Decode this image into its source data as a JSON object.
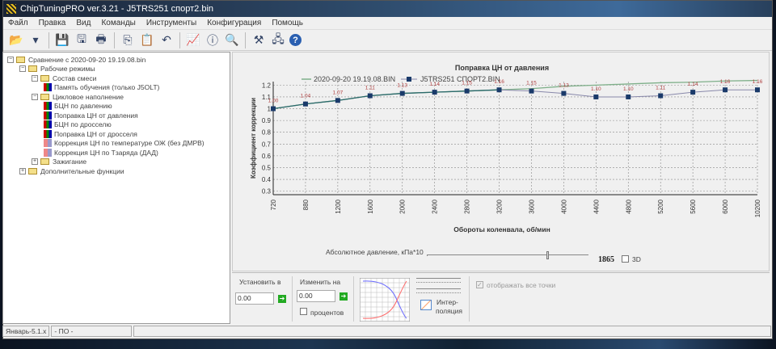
{
  "window": {
    "title": "ChipTuningPRO ver.3.21 - J5TRS251 спорт2.bin"
  },
  "menu": [
    "Файл",
    "Правка",
    "Вид",
    "Команды",
    "Инструменты",
    "Конфигурация",
    "Помощь"
  ],
  "toolbar": {
    "icons": [
      "open-icon",
      "dropdown-icon",
      "save-icon",
      "save-as-icon",
      "print-icon",
      "copy-icon",
      "paste-icon",
      "undo-icon",
      "chart-icon",
      "info-icon",
      "search-icon",
      "tools-icon",
      "network-icon",
      "help-icon"
    ]
  },
  "tree": [
    {
      "label": "Сравнение с 2020-09-20 19.19.08.bin",
      "level": 0,
      "type": "folder",
      "exp": "−"
    },
    {
      "label": "Рабочие режимы",
      "level": 1,
      "type": "folder",
      "exp": "−"
    },
    {
      "label": "Состав смеси",
      "level": 2,
      "type": "folder",
      "exp": "−"
    },
    {
      "label": "Память обучения (только J5OLT)",
      "level": 3,
      "type": "map"
    },
    {
      "label": "Цикловое наполнение",
      "level": 2,
      "type": "folder",
      "exp": "−"
    },
    {
      "label": "БЦН по давлению",
      "level": 3,
      "type": "map"
    },
    {
      "label": "Поправка ЦН от давления",
      "level": 3,
      "type": "map"
    },
    {
      "label": "БЦН по дросселю",
      "level": 3,
      "type": "map"
    },
    {
      "label": "Поправка ЦН от дросселя",
      "level": 3,
      "type": "map"
    },
    {
      "label": "Коррекция ЦН по температуре ОЖ (без ДМРВ)",
      "level": 3,
      "type": "map2"
    },
    {
      "label": "Коррекция ЦН по Тзаряда (ДАД)",
      "level": 3,
      "type": "map2"
    },
    {
      "label": "Зажигание",
      "level": 2,
      "type": "folder",
      "exp": "+"
    },
    {
      "label": "Дополнительные функции",
      "level": 1,
      "type": "folder",
      "exp": "+"
    }
  ],
  "chart_data": {
    "type": "line",
    "title": "Поправка ЦН от давления",
    "xlabel": "Обороты коленвала, об/мин",
    "ylabel": "Коэффициент коррекции",
    "categories": [
      "720",
      "880",
      "1200",
      "1600",
      "2000",
      "2400",
      "2800",
      "3200",
      "3600",
      "4000",
      "4400",
      "4800",
      "5200",
      "5600",
      "6000",
      "10200"
    ],
    "yticks": [
      "1.2",
      "1.1",
      "1",
      "0.9",
      "0.8",
      "0.7",
      "0.6",
      "0.5",
      "0.4",
      "0.3"
    ],
    "ylim": [
      0.27,
      1.23
    ],
    "grid": true,
    "legend": "top",
    "series": [
      {
        "name": "2020-09-20 19.19.08.BIN",
        "color": "#7fb08a",
        "values": [
          1.0,
          1.04,
          1.07,
          1.11,
          1.13,
          1.14,
          1.15,
          1.16,
          1.17,
          1.19,
          1.2,
          1.21,
          1.22,
          1.225,
          1.235,
          1.24
        ]
      },
      {
        "name": "J5TRS251 СПОРТ2.BIN",
        "color": "#8888aa",
        "marker": "#1a3a6a",
        "values": [
          1.0,
          1.04,
          1.07,
          1.11,
          1.13,
          1.14,
          1.15,
          1.16,
          1.15,
          1.13,
          1.1,
          1.1,
          1.11,
          1.14,
          1.16,
          1.16
        ],
        "labels": [
          "1.00",
          "1.04",
          "1.07",
          "1.11",
          "1.13",
          "1.14",
          "1.15",
          "1.16",
          "1.15",
          "1.13",
          "1.10",
          "1.10",
          "1.11",
          "1.14",
          "1.16",
          "1.16"
        ]
      }
    ]
  },
  "pressure": {
    "label": "Абсолютное давление, кПа*10",
    "value": "1865",
    "slider_fraction": 0.75,
    "check3d": "3D"
  },
  "bottom": {
    "set_label": "Установить в",
    "set_value": "0.00",
    "change_label": "Изменить на",
    "change_value": "0.00",
    "percent": "процентов",
    "interp1": "Интер-",
    "interp2": "поляция",
    "show_all": "отображать все точки"
  },
  "status": [
    "Январь-5.1.x",
    "- ПО -"
  ]
}
